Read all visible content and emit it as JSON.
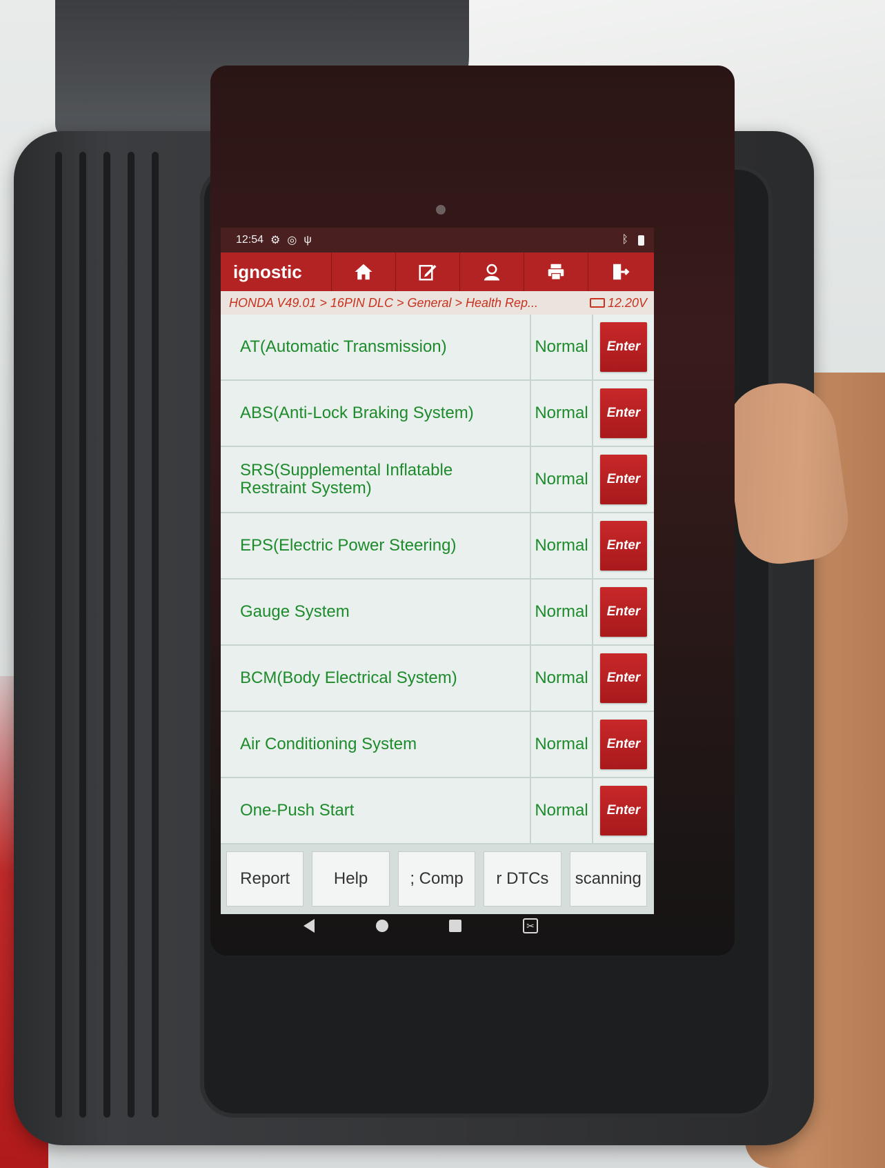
{
  "statusbar": {
    "time": "12:54",
    "icons": [
      "gear-icon",
      "camera-icon",
      "usb-icon",
      "bluetooth-icon",
      "battery-icon"
    ]
  },
  "toolbar": {
    "title": "ignostic",
    "buttons": [
      {
        "name": "home",
        "icon": "home-icon"
      },
      {
        "name": "edit",
        "icon": "edit-icon"
      },
      {
        "name": "user",
        "icon": "user-icon"
      },
      {
        "name": "print",
        "icon": "print-icon"
      },
      {
        "name": "exit",
        "icon": "exit-icon"
      }
    ]
  },
  "breadcrumb": {
    "path": "HONDA V49.01 > 16PIN DLC > General > Health Rep...",
    "voltage": "12.20V"
  },
  "systems": [
    {
      "name": "AT(Automatic Transmission)",
      "status": "Normal",
      "action": "Enter"
    },
    {
      "name": "ABS(Anti-Lock Braking System)",
      "status": "Normal",
      "action": "Enter"
    },
    {
      "name": "SRS(Supplemental Inflatable Restraint System)",
      "status": "Normal",
      "action": "Enter"
    },
    {
      "name": "EPS(Electric Power Steering)",
      "status": "Normal",
      "action": "Enter"
    },
    {
      "name": "Gauge System",
      "status": "Normal",
      "action": "Enter"
    },
    {
      "name": "BCM(Body Electrical System)",
      "status": "Normal",
      "action": "Enter"
    },
    {
      "name": "Air Conditioning System",
      "status": "Normal",
      "action": "Enter"
    },
    {
      "name": "One-Push Start",
      "status": "Normal",
      "action": "Enter"
    }
  ],
  "bottom_buttons": [
    "Report",
    "Help",
    "; Comp",
    "r DTCs",
    "scanning"
  ],
  "colors": {
    "accent_red": "#b42323",
    "status_green": "#1d8b2b",
    "enter_red": "#c8282a"
  }
}
